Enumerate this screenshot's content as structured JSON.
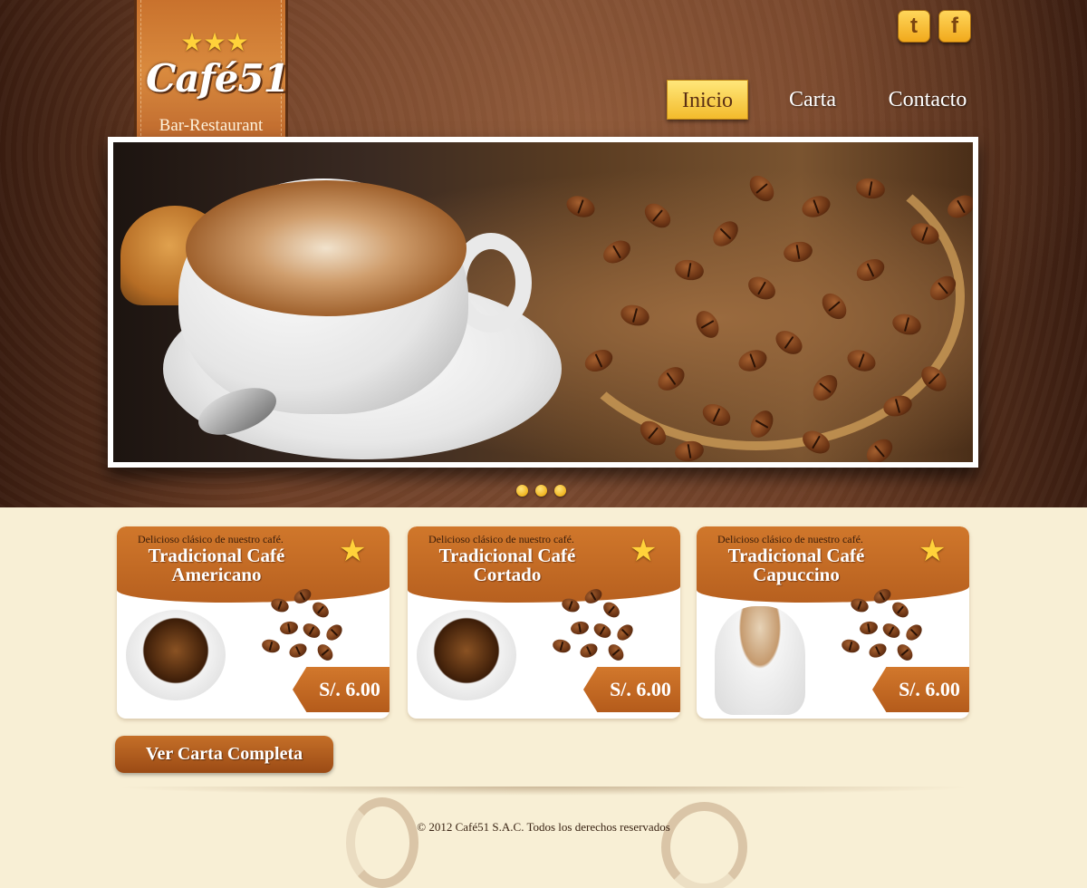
{
  "brand": {
    "stars": "★★★",
    "name": "Café51",
    "tagline": "Bar-Restaurant"
  },
  "social": [
    {
      "name": "twitter",
      "glyph": "t"
    },
    {
      "name": "facebook",
      "glyph": "f"
    }
  ],
  "nav": {
    "items": [
      {
        "label": "Inicio",
        "active": true
      },
      {
        "label": "Carta",
        "active": false
      },
      {
        "label": "Contacto",
        "active": false
      }
    ]
  },
  "slider": {
    "slide_count": 3
  },
  "products": [
    {
      "tagline": "Delicioso clásico de nuestro café.",
      "title_line1": "Tradicional Café",
      "title_line2": "Americano",
      "price": "S/. 6.00"
    },
    {
      "tagline": "Delicioso clásico de nuestro café.",
      "title_line1": "Tradicional Café",
      "title_line2": "Cortado",
      "price": "S/. 6.00"
    },
    {
      "tagline": "Delicioso clásico de nuestro café.",
      "title_line1": "Tradicional Café",
      "title_line2": "Capuccino",
      "price": "S/. 6.00"
    }
  ],
  "cta": {
    "label": "Ver Carta Completa"
  },
  "footer": {
    "copyright": "© 2012 Café51 S.A.C. Todos los derechos reservados"
  },
  "colors": {
    "header_brown": "#6e3f27",
    "accent_orange": "#c9722d",
    "nav_active": "#f3bb2c",
    "page_cream": "#f8efd5"
  }
}
